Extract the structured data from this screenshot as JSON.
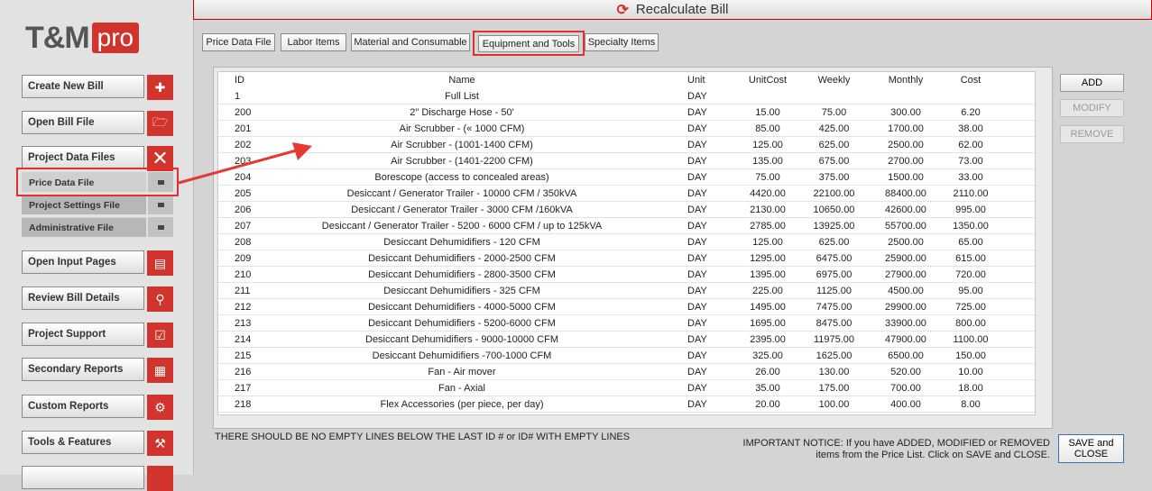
{
  "logo": {
    "main": "T&M",
    "badge": "pro"
  },
  "header": {
    "title": "Recalculate Bill"
  },
  "sidebar": {
    "buttons": [
      {
        "label": "Create New Bill",
        "icon": "new-file-icon"
      },
      {
        "label": "Open Bill File",
        "icon": "folder-icon"
      },
      {
        "label": "Project Data Files",
        "icon": "close-icon"
      },
      {
        "label": "Open Input Pages",
        "icon": "document-icon"
      },
      {
        "label": "Review Bill Details",
        "icon": "review-icon"
      },
      {
        "label": "Project Support",
        "icon": "checklist-icon"
      },
      {
        "label": "Secondary Reports",
        "icon": "report-icon"
      },
      {
        "label": "Custom Reports",
        "icon": "gear-icon"
      },
      {
        "label": "Tools & Features",
        "icon": "tools-icon"
      }
    ],
    "subitems": [
      {
        "label": "Price Data File"
      },
      {
        "label": "Project Settings File"
      },
      {
        "label": "Administrative File"
      }
    ]
  },
  "tabs": [
    {
      "label": "Price Data File"
    },
    {
      "label": "Labor Items"
    },
    {
      "label": "Material and Consumable"
    },
    {
      "label": "Equipment and Tools"
    },
    {
      "label": "Specialty Items"
    }
  ],
  "table": {
    "columns": {
      "id": "ID",
      "name": "Name",
      "unit": "Unit",
      "unitcost": "UnitCost",
      "weekly": "Weekly",
      "monthly": "Monthly",
      "cost": "Cost"
    },
    "rows": [
      {
        "id": "1",
        "name": "Full List",
        "unit": "DAY",
        "unitcost": "",
        "weekly": "",
        "monthly": "",
        "cost": ""
      },
      {
        "id": "200",
        "name": "2\" Discharge Hose - 50'",
        "unit": "DAY",
        "unitcost": "15.00",
        "weekly": "75.00",
        "monthly": "300.00",
        "cost": "6.20"
      },
      {
        "id": "201",
        "name": "Air Scrubber - (« 1000 CFM)",
        "unit": "DAY",
        "unitcost": "85.00",
        "weekly": "425.00",
        "monthly": "1700.00",
        "cost": "38.00"
      },
      {
        "id": "202",
        "name": "Air Scrubber - (1001-1400 CFM)",
        "unit": "DAY",
        "unitcost": "125.00",
        "weekly": "625.00",
        "monthly": "2500.00",
        "cost": "62.00"
      },
      {
        "id": "203",
        "name": "Air Scrubber - (1401-2200 CFM)",
        "unit": "DAY",
        "unitcost": "135.00",
        "weekly": "675.00",
        "monthly": "2700.00",
        "cost": "73.00"
      },
      {
        "id": "204",
        "name": "Borescope (access to concealed areas)",
        "unit": "DAY",
        "unitcost": "75.00",
        "weekly": "375.00",
        "monthly": "1500.00",
        "cost": "33.00"
      },
      {
        "id": "205",
        "name": "Desiccant / Generator Trailer - 10000 CFM / 350kVA",
        "unit": "DAY",
        "unitcost": "4420.00",
        "weekly": "22100.00",
        "monthly": "88400.00",
        "cost": "2110.00"
      },
      {
        "id": "206",
        "name": "Desiccant / Generator Trailer - 3000 CFM /160kVA",
        "unit": "DAY",
        "unitcost": "2130.00",
        "weekly": "10650.00",
        "monthly": "42600.00",
        "cost": "995.00"
      },
      {
        "id": "207",
        "name": "Desiccant / Generator Trailer - 5200 - 6000 CFM / up to 125kVA",
        "unit": "DAY",
        "unitcost": "2785.00",
        "weekly": "13925.00",
        "monthly": "55700.00",
        "cost": "1350.00"
      },
      {
        "id": "208",
        "name": "Desiccant Dehumidifiers - 120 CFM",
        "unit": "DAY",
        "unitcost": "125.00",
        "weekly": "625.00",
        "monthly": "2500.00",
        "cost": "65.00"
      },
      {
        "id": "209",
        "name": "Desiccant Dehumidifiers - 2000-2500 CFM",
        "unit": "DAY",
        "unitcost": "1295.00",
        "weekly": "6475.00",
        "monthly": "25900.00",
        "cost": "615.00"
      },
      {
        "id": "210",
        "name": "Desiccant Dehumidifiers - 2800-3500 CFM",
        "unit": "DAY",
        "unitcost": "1395.00",
        "weekly": "6975.00",
        "monthly": "27900.00",
        "cost": "720.00"
      },
      {
        "id": "211",
        "name": "Desiccant Dehumidifiers - 325 CFM",
        "unit": "DAY",
        "unitcost": "225.00",
        "weekly": "1125.00",
        "monthly": "4500.00",
        "cost": "95.00"
      },
      {
        "id": "212",
        "name": "Desiccant Dehumidifiers - 4000-5000 CFM",
        "unit": "DAY",
        "unitcost": "1495.00",
        "weekly": "7475.00",
        "monthly": "29900.00",
        "cost": "725.00"
      },
      {
        "id": "213",
        "name": "Desiccant Dehumidifiers - 5200-6000 CFM",
        "unit": "DAY",
        "unitcost": "1695.00",
        "weekly": "8475.00",
        "monthly": "33900.00",
        "cost": "800.00"
      },
      {
        "id": "214",
        "name": "Desiccant Dehumidifiers - 9000-10000 CFM",
        "unit": "DAY",
        "unitcost": "2395.00",
        "weekly": "11975.00",
        "monthly": "47900.00",
        "cost": "1100.00"
      },
      {
        "id": "215",
        "name": "Desiccant Dehumidifiers -700-1000 CFM",
        "unit": "DAY",
        "unitcost": "325.00",
        "weekly": "1625.00",
        "monthly": "6500.00",
        "cost": "150.00"
      },
      {
        "id": "216",
        "name": "Fan - Air mover",
        "unit": "DAY",
        "unitcost": "26.00",
        "weekly": "130.00",
        "monthly": "520.00",
        "cost": "10.00"
      },
      {
        "id": "217",
        "name": "Fan - Axial",
        "unit": "DAY",
        "unitcost": "35.00",
        "weekly": "175.00",
        "monthly": "700.00",
        "cost": "18.00"
      },
      {
        "id": "218",
        "name": "Flex Accessories (per piece, per day)",
        "unit": "DAY",
        "unitcost": "20.00",
        "weekly": "100.00",
        "monthly": "400.00",
        "cost": "8.00"
      }
    ]
  },
  "actions": {
    "add": "ADD",
    "modify": "MODIFY",
    "remove": "REMOVE"
  },
  "warning": "THERE SHOULD BE NO EMPTY LINES BELOW THE LAST ID # or ID# WITH EMPTY LINES",
  "notice": {
    "line1": "IMPORTANT NOTICE:  If you have ADDED, MODIFIED or REMOVED",
    "line2": "items from the Price List.  Click on SAVE and CLOSE."
  },
  "save_close": {
    "line1": "SAVE and",
    "line2": "CLOSE"
  },
  "colors": {
    "accent": "#d0342c",
    "highlight": "#e03030"
  }
}
